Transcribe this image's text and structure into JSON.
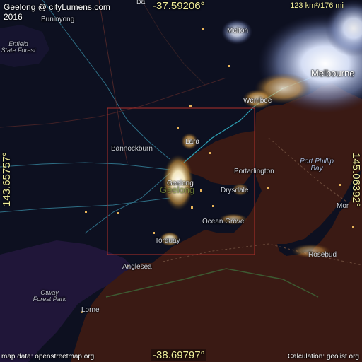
{
  "header": {
    "title": "Geelong @ cityLumens.com",
    "year": "2016"
  },
  "coordinates": {
    "top_lat": "-37.59206°",
    "bottom_lat": "-38.69797°",
    "left_lon": "143.65757°",
    "right_lon": "145.06392°"
  },
  "scale": {
    "text": "123 km²/176 mi"
  },
  "places": {
    "ballarat_fragment": "Ba",
    "buninyong": "Buninyong",
    "enfield_state_forest": "Enfield\nState Forest",
    "melton": "Melton",
    "melbourne": "Melbourne",
    "werribee": "Werribee",
    "bannockburn": "Bannockburn",
    "lara": "Lara",
    "geelong_small": "Geelong",
    "geelong_big": "Geelong",
    "portarlington": "Portarlington",
    "port_phillip_bay": "Port Phillip\nBay",
    "drysdale": "Drysdale",
    "mornington_fragment": "Mor",
    "ocean_grove": "Ocean Grove",
    "torquay": "Torquay",
    "rosebud": "Rosebud",
    "anglesea": "Anglesea",
    "otway_forest_park": "Otway\nForest Park",
    "lorne": "Lorne"
  },
  "footer": {
    "map_data": "map data: openstreetmap.org",
    "calculation": "Calculation: geolist.org"
  },
  "colors": {
    "land": "#0d1020",
    "sea": "#3a1a14",
    "highlight_box": "#b0302a",
    "coord_text": "#f1ee9a",
    "light_core": "#fffbe6",
    "light_warm": "#f2b64a",
    "light_cool": "#cfe0ff"
  },
  "icons": {
    "highlight_frame": "highlight-rectangle"
  }
}
